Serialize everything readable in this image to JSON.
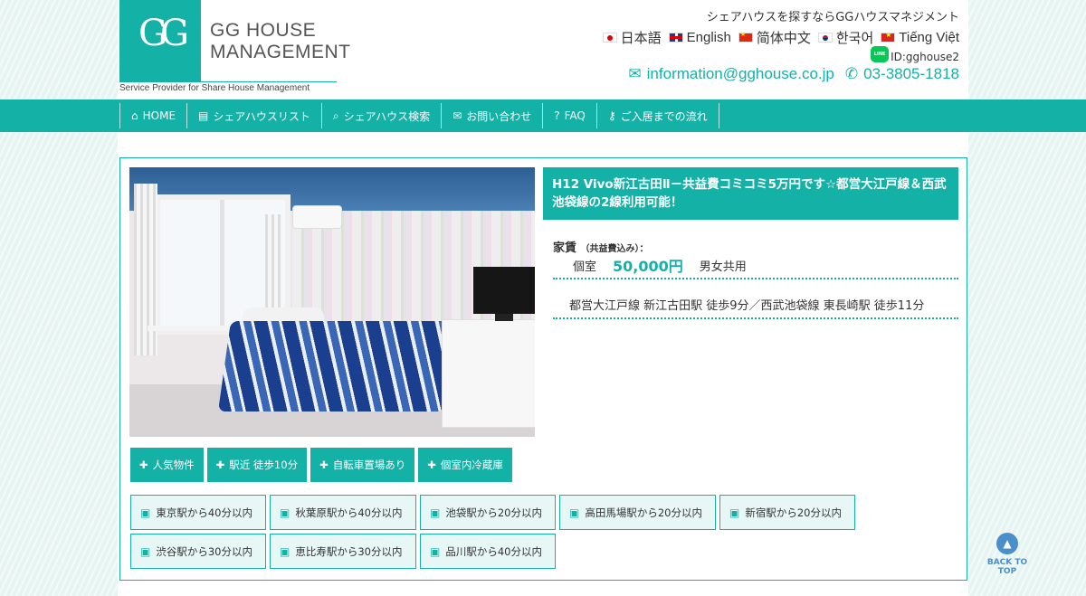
{
  "header": {
    "logo_mark": "GG",
    "logo_line1": "GG HOUSE",
    "logo_line2": "MANAGEMENT",
    "tagline": "Service Provider for Share House Management",
    "top_text": "シェアハウスを探すならGGハウスマネジメント",
    "languages": [
      {
        "label": "日本語",
        "flag": "jp"
      },
      {
        "label": "English",
        "flag": "gb"
      },
      {
        "label": "简体中文",
        "flag": "cn"
      },
      {
        "label": "한국어",
        "flag": "kr"
      },
      {
        "label": "Tiếng Việt",
        "flag": "vn"
      }
    ],
    "line_icon_text": "LINE",
    "line_id": "ID:gghouse2",
    "email": "information@gghouse.co.jp",
    "phone": "03-3805-1818",
    "brand_color": "#14b1a7"
  },
  "nav": {
    "items": [
      {
        "label": "HOME",
        "icon": "home-icon",
        "glyph": "⌂"
      },
      {
        "label": "シェアハウスリスト",
        "icon": "clipboard-icon",
        "glyph": "▤"
      },
      {
        "label": "シェアハウス検索",
        "icon": "search-icon",
        "glyph": "⌕"
      },
      {
        "label": "お問い合わせ",
        "icon": "envelope-icon",
        "glyph": "✉"
      },
      {
        "label": "FAQ",
        "icon": "question-icon",
        "glyph": "?"
      },
      {
        "label": "ご入居までの流れ",
        "icon": "key-icon",
        "glyph": "⚷"
      }
    ]
  },
  "listing": {
    "title": "H12 Vivo新江古田Ⅱ－共益費コミコミ5万円です☆都営大江戸線＆西武池袋線の2線利用可能！",
    "rent_label": "家賃",
    "rent_note": "（共益費込み）：",
    "room_type": "個室",
    "price": "50,000円",
    "gender": "男女共用",
    "access": "都営大江戸線 新江古田駅 徒歩9分／西武池袋線 東長崎駅 徒歩11分",
    "tags": [
      "人気物件",
      "駅近 徒歩10分",
      "自転車置場あり",
      "個室内冷蔵庫"
    ],
    "stations": [
      "東京駅から40分以内",
      "秋葉原駅から40分以内",
      "池袋駅から20分以内",
      "高田馬場駅から20分以内",
      "新宿駅から20分以内",
      "渋谷駅から30分以内",
      "恵比寿駅から30分以内",
      "品川駅から40分以内"
    ]
  },
  "back_to_top": "BACK TO TOP"
}
